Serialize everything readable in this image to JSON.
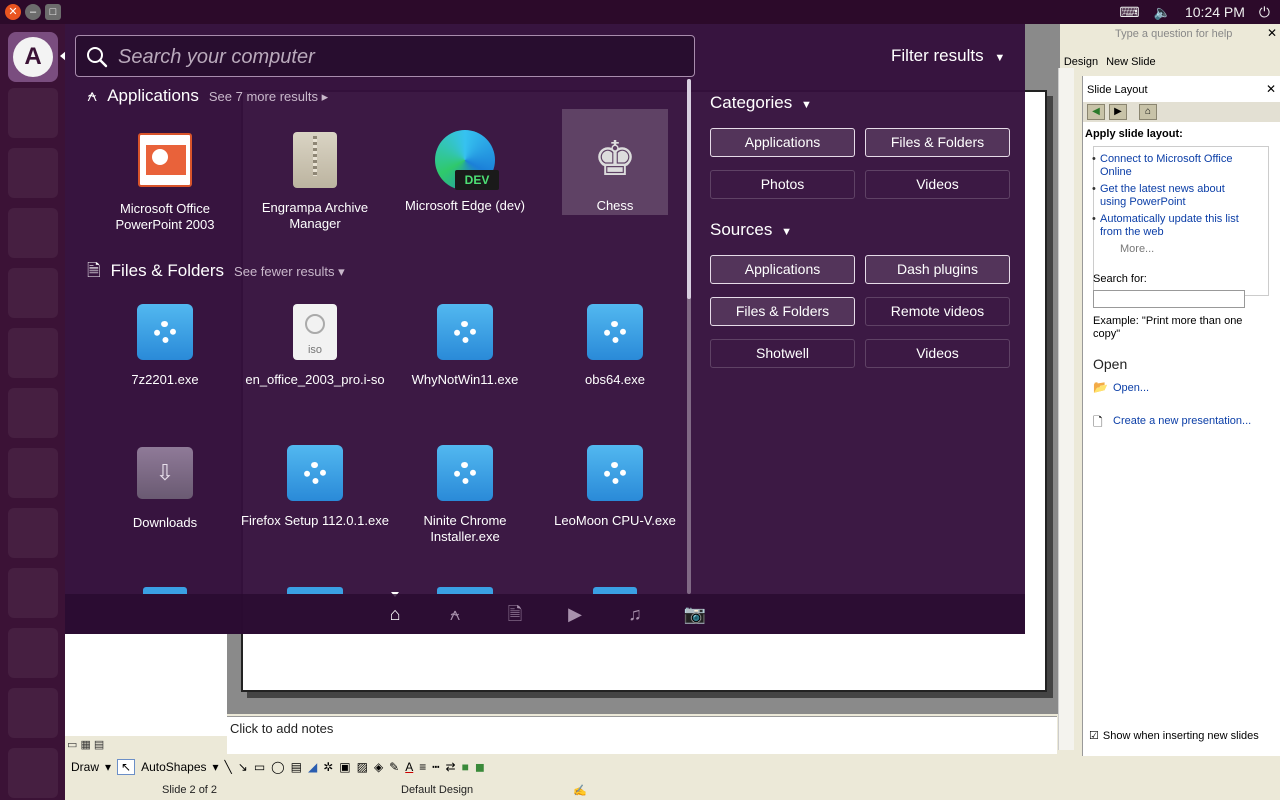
{
  "top_panel": {
    "time": "10:24 PM",
    "close_label": "✕",
    "min_label": "–",
    "max_label": "□"
  },
  "launcher": {
    "home_glyph": "A"
  },
  "dash": {
    "search": {
      "placeholder": "Search your computer",
      "value": ""
    },
    "filter_results_label": "Filter results",
    "applications": {
      "title": "Applications",
      "more_label": "See 7 more results",
      "items": [
        {
          "label": "Microsoft Office PowerPoint 2003",
          "icon": "powerpoint-icon"
        },
        {
          "label": "Engrampa Archive Manager",
          "icon": "archive-icon"
        },
        {
          "label": "Microsoft Edge (dev)",
          "icon": "edge-dev-icon"
        },
        {
          "label": "Chess",
          "icon": "chess-icon"
        }
      ]
    },
    "files": {
      "title": "Files & Folders",
      "more_label": "See fewer results",
      "items": [
        {
          "label": "7z2201.exe"
        },
        {
          "label": "en_office_2003_pro.i-so"
        },
        {
          "label": "WhyNotWin11.exe"
        },
        {
          "label": "obs64.exe"
        },
        {
          "label": "Downloads"
        },
        {
          "label": "Firefox Setup 112.0.1.exe"
        },
        {
          "label": "Ninite Chrome Installer.exe"
        },
        {
          "label": "LeoMoon CPU-V.exe"
        }
      ]
    },
    "iso_label": "iso",
    "edge_badge": "DEV",
    "categories": {
      "title": "Categories",
      "buttons": [
        "Applications",
        "Files & Folders",
        "Photos",
        "Videos"
      ]
    },
    "sources": {
      "title": "Sources",
      "buttons": [
        "Applications",
        "Dash plugins",
        "Files & Folders",
        "Remote videos",
        "Shotwell",
        "Videos"
      ]
    }
  },
  "ppt": {
    "help_placeholder": "Type a question for help",
    "toolbar_design": "Design",
    "toolbar_new_slide": "New Slide",
    "task_pane": {
      "title": "Slide Layout",
      "apply_heading": "Apply slide layout:",
      "links": [
        "Connect to Microsoft Office Online",
        "Get the latest news about using PowerPoint",
        "Automatically update this list from the web"
      ],
      "more": "More...",
      "search_label": "Search for:",
      "example": "Example:  \"Print more than one copy\"",
      "open_heading": "Open",
      "open_link": "Open...",
      "new_presentation": "Create a new presentation...",
      "show_when": "Show when inserting new slides"
    },
    "notes_placeholder": "Click to add notes",
    "draw_toolbar": {
      "draw": "Draw",
      "autoshapes": "AutoShapes"
    },
    "status": {
      "slide": "Slide 2 of 2",
      "design": "Default Design"
    }
  },
  "colors": {
    "dash_bg": "#34103c",
    "accent": "#e95420",
    "link": "#0b3ea7"
  }
}
